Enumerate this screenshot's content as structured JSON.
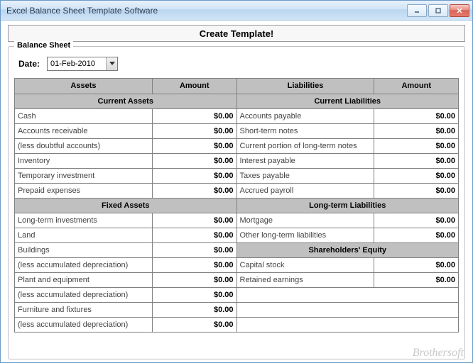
{
  "window": {
    "title": "Excel Balance Sheet Template Software"
  },
  "create_button": "Create Template!",
  "fieldset_legend": "Balance Sheet",
  "date": {
    "label": "Date:",
    "value": "01-Feb-2010"
  },
  "columns": {
    "left_header1": "Assets",
    "left_header2": "Amount",
    "right_header1": "Liabilities",
    "right_header2": "Amount"
  },
  "left_sections": [
    {
      "title": "Current Assets",
      "rows": [
        {
          "name": "Cash",
          "amount": "$0.00"
        },
        {
          "name": "Accounts receivable",
          "amount": "$0.00"
        },
        {
          "name": "(less doubtful accounts)",
          "amount": "$0.00"
        },
        {
          "name": "Inventory",
          "amount": "$0.00"
        },
        {
          "name": "Temporary investment",
          "amount": "$0.00"
        },
        {
          "name": "Prepaid expenses",
          "amount": "$0.00"
        }
      ]
    },
    {
      "title": "Fixed Assets",
      "rows": [
        {
          "name": "Long-term investments",
          "amount": "$0.00"
        },
        {
          "name": "Land",
          "amount": "$0.00"
        },
        {
          "name": "Buildings",
          "amount": "$0.00"
        },
        {
          "name": "(less accumulated depreciation)",
          "amount": "$0.00"
        },
        {
          "name": "Plant and equipment",
          "amount": "$0.00"
        },
        {
          "name": "(less accumulated depreciation)",
          "amount": "$0.00"
        },
        {
          "name": "Furniture and fixtures",
          "amount": "$0.00"
        },
        {
          "name": "(less accumulated depreciation)",
          "amount": "$0.00"
        }
      ]
    }
  ],
  "right_sections": [
    {
      "title": "Current Liabilities",
      "rows": [
        {
          "name": "Accounts payable",
          "amount": "$0.00"
        },
        {
          "name": "Short-term notes",
          "amount": "$0.00"
        },
        {
          "name": "Current portion of long-term notes",
          "amount": "$0.00"
        },
        {
          "name": "Interest payable",
          "amount": "$0.00"
        },
        {
          "name": "Taxes payable",
          "amount": "$0.00"
        },
        {
          "name": "Accrued payroll",
          "amount": "$0.00"
        }
      ]
    },
    {
      "title": "Long-term Liabilities",
      "rows": [
        {
          "name": "Mortgage",
          "amount": "$0.00"
        },
        {
          "name": "Other long-term liabilities",
          "amount": "$0.00"
        }
      ]
    },
    {
      "title": "Shareholders' Equity",
      "rows": [
        {
          "name": "Capital stock",
          "amount": "$0.00"
        },
        {
          "name": "Retained earnings",
          "amount": "$0.00"
        }
      ]
    }
  ],
  "watermark": "Brothersoft"
}
